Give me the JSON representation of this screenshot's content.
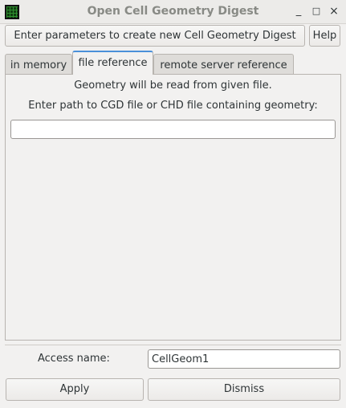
{
  "window": {
    "title": "Open Cell Geometry Digest",
    "minimize": "_",
    "maximize": "□",
    "close": "×"
  },
  "header": {
    "prompt_label": "Enter parameters to create new Cell Geometry Digest",
    "help_label": "Help"
  },
  "tabs": [
    {
      "label": "in memory",
      "selected": false
    },
    {
      "label": "file reference",
      "selected": true
    },
    {
      "label": "remote server reference",
      "selected": false
    }
  ],
  "panel": {
    "info_line1": "Geometry will be read from given file.",
    "info_line2": "Enter path to CGD file or CHD file containing geometry:",
    "path_value": ""
  },
  "access": {
    "label": "Access name:",
    "value": "CellGeom1"
  },
  "buttons": {
    "apply": "Apply",
    "dismiss": "Dismiss"
  }
}
